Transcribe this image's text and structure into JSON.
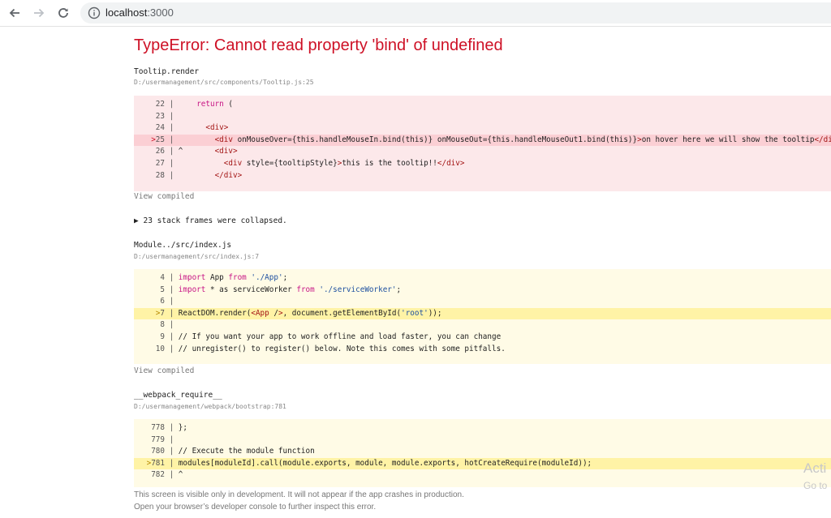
{
  "browser": {
    "url_host": "localhost",
    "url_port": ":3000"
  },
  "error": {
    "title": "TypeError: Cannot read property 'bind' of undefined"
  },
  "frames": [
    {
      "name": "Tooltip.render",
      "location": "D:/usermanagement/src/components/Tooltip.js:25",
      "lines": [
        {
          "num": "22",
          "marker": " ",
          "code": "    return ("
        },
        {
          "num": "23",
          "marker": " ",
          "code": ""
        },
        {
          "num": "24",
          "marker": " ",
          "code": "      <div>"
        },
        {
          "num": "25",
          "marker": ">",
          "code": "        <div onMouseOver={this.handleMouseIn.bind(this)} onMouseOut={this.handleMouseOut1.bind(this)}>on hover here we will show the tooltip</div>"
        },
        {
          "num": "26",
          "marker": " ",
          "code": "^       <div>"
        },
        {
          "num": "27",
          "marker": " ",
          "code": "          <div style={tooltipStyle}>this is the tooltip!!</div>"
        },
        {
          "num": "28",
          "marker": " ",
          "code": "        </div>"
        }
      ],
      "view_compiled": "View compiled"
    },
    {
      "name": "Module../src/index.js",
      "location": "D:/usermanagement/src/index.js:7",
      "lines": [
        {
          "num": "4",
          "marker": " ",
          "code": "import App from './App';"
        },
        {
          "num": "5",
          "marker": " ",
          "code": "import * as serviceWorker from './serviceWorker';"
        },
        {
          "num": "6",
          "marker": " ",
          "code": ""
        },
        {
          "num": "7",
          "marker": ">",
          "code": "ReactDOM.render(<App />, document.getElementById('root'));"
        },
        {
          "num": "8",
          "marker": " ",
          "code": ""
        },
        {
          "num": "9",
          "marker": " ",
          "code": "// If you want your app to work offline and load faster, you can change"
        },
        {
          "num": "10",
          "marker": " ",
          "code": "// unregister() to register() below. Note this comes with some pitfalls."
        }
      ],
      "view_compiled": "View compiled"
    },
    {
      "name": "__webpack_require__",
      "location": "D:/usermanagement/webpack/bootstrap:781",
      "lines": [
        {
          "num": "778",
          "marker": " ",
          "code": "};"
        },
        {
          "num": "779",
          "marker": " ",
          "code": ""
        },
        {
          "num": "780",
          "marker": " ",
          "code": "// Execute the module function"
        },
        {
          "num": "781",
          "marker": ">",
          "code": "modules[moduleId].call(module.exports, module, module.exports, hotCreateRequire(moduleId));"
        },
        {
          "num": "782",
          "marker": " ",
          "code": "^"
        }
      ]
    }
  ],
  "collapsed": {
    "arrow": "▶",
    "label": "23 stack frames were collapsed."
  },
  "footer": {
    "line1": "This screen is visible only in development. It will not appear if the app crashes in production.",
    "line2": "Open your browser’s developer console to further inspect this error."
  },
  "watermark": {
    "line1": "Acti",
    "line2": "Go to"
  },
  "colors": {
    "error_red": "#ce1126",
    "red_box": "#fce8ea",
    "yellow_box": "#fffbe6"
  }
}
